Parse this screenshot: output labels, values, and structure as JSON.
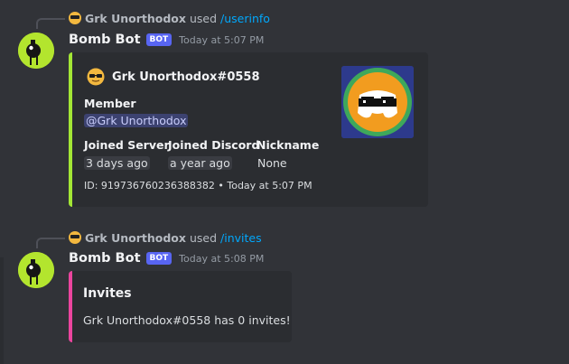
{
  "colors": {
    "background": "#313338",
    "embed_bg": "#2b2d31",
    "userinfo_accent": "#a3e635",
    "invites_accent": "#eb459e",
    "bot_badge": "#5865f2",
    "link": "#00a8fc"
  },
  "messages": [
    {
      "reply": {
        "icon": "sunglasses-emoji-icon",
        "user": "Grk Unorthodox",
        "verb": "used",
        "command": "/userinfo"
      },
      "author": "Bomb Bot",
      "badge": "BOT",
      "timestamp": "Today at 5:07 PM",
      "embed": {
        "author_name": "Grk Unorthodox#0558",
        "member_label": "Member",
        "member_mention": "@Grk Unorthodox",
        "fields": [
          {
            "name": "Joined Server",
            "value": "3 days ago"
          },
          {
            "name": "Joined Discord",
            "value": "a year ago"
          },
          {
            "name": "Nickname",
            "value": "None"
          }
        ],
        "footer": "ID: 919736760236388382 • Today at 5:07 PM",
        "thumbnail": "discord-logo-sunglasses-avatar"
      }
    },
    {
      "reply": {
        "icon": "sunglasses-emoji-icon",
        "user": "Grk Unorthodox",
        "verb": "used",
        "command": "/invites"
      },
      "author": "Bomb Bot",
      "badge": "BOT",
      "timestamp": "Today at 5:08 PM",
      "embed": {
        "title": "Invites",
        "description": "Grk Unorthodox#0558 has 0 invites!"
      }
    }
  ]
}
